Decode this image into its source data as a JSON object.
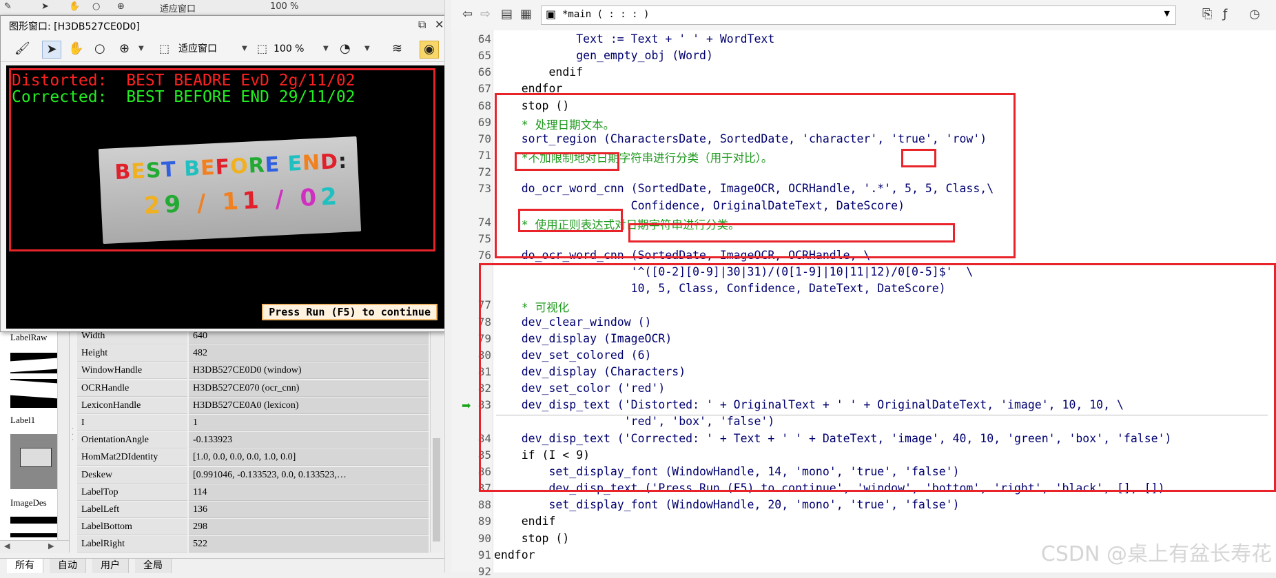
{
  "back_toolbar": {
    "text_fit": "适应窗口",
    "text_zoom": "100 %"
  },
  "graphics_window": {
    "title": "图形窗口: [H3DB527CE0D0]",
    "toolbar": {
      "fit_label": "适应窗口",
      "zoom_value": "100 %"
    },
    "canvas": {
      "distorted_label": "Distorted:",
      "distorted_text": "BEST BEADRE EvD 2g/11/02",
      "corrected_label": "Corrected:",
      "corrected_text": "BEST BEFORE END 29/11/02",
      "label_line1": "BEST BEFORE END:",
      "label_line2": "29 / 11 / 02",
      "press_run": "Press Run (F5) to continue"
    }
  },
  "variables": {
    "thumbs": [
      {
        "label": "LabelRaw"
      },
      {
        "label": "Label1"
      },
      {
        "label": "ImageDes"
      }
    ],
    "rows": [
      {
        "name": "Width",
        "value": "640"
      },
      {
        "name": "Height",
        "value": "482"
      },
      {
        "name": "WindowHandle",
        "value": "H3DB527CE0D0 (window)"
      },
      {
        "name": "OCRHandle",
        "value": "H3DB527CE070 (ocr_cnn)"
      },
      {
        "name": "LexiconHandle",
        "value": "H3DB527CE0A0 (lexicon)"
      },
      {
        "name": "I",
        "value": "1"
      },
      {
        "name": "OrientationAngle",
        "value": "-0.133923"
      },
      {
        "name": "HomMat2DIdentity",
        "value": "[1.0, 0.0, 0.0, 0.0, 1.0, 0.0]"
      },
      {
        "name": "Deskew",
        "value": "[0.991046, -0.133523, 0.0, 0.133523,…"
      },
      {
        "name": "LabelTop",
        "value": "114"
      },
      {
        "name": "LabelLeft",
        "value": "136"
      },
      {
        "name": "LabelBottom",
        "value": "298"
      },
      {
        "name": "LabelRight",
        "value": "522"
      }
    ],
    "tabs": [
      "所有",
      "自动",
      "用户",
      "全局"
    ]
  },
  "editor": {
    "procedure": "*main ( : : : )",
    "lines": [
      {
        "n": "64",
        "t": "            Text := Text + ' ' + WordText",
        "c": "op"
      },
      {
        "n": "65",
        "t": "            gen_empty_obj (Word)",
        "c": "op"
      },
      {
        "n": "66",
        "t": "        endif",
        "c": "kw"
      },
      {
        "n": "67",
        "t": "    endfor",
        "c": "kw"
      },
      {
        "n": "68",
        "t": "    stop ()",
        "c": "kw"
      },
      {
        "n": "69",
        "t": "    * 处理日期文本。",
        "c": "cm"
      },
      {
        "n": "70",
        "t": "    sort_region (CharactersDate, SortedDate, 'character', 'true', 'row')",
        "c": "op"
      },
      {
        "n": "71",
        "t": "    *不加限制地对日期字符串进行分类（用于对比）。",
        "c": "cm"
      },
      {
        "n": "72",
        "t": "",
        "c": "op"
      },
      {
        "n": "73",
        "t": "    do_ocr_word_cnn (SortedDate, ImageOCR, OCRHandle, '.*', 5, 5, Class,\\",
        "c": "op"
      },
      {
        "n": "",
        "t": "                    Confidence, OriginalDateText, DateScore)",
        "c": "op"
      },
      {
        "n": "74",
        "t": "    * 使用正则表达式对日期字符串进行分类。",
        "c": "cm"
      },
      {
        "n": "75",
        "t": "",
        "c": "op"
      },
      {
        "n": "76",
        "t": "    do_ocr_word_cnn (SortedDate, ImageOCR, OCRHandle, \\",
        "c": "op"
      },
      {
        "n": "",
        "t": "                    '^([0-2][0-9]|30|31)/(0[1-9]|10|11|12)/0[0-5]$'  \\",
        "c": "op"
      },
      {
        "n": "",
        "t": "                    10, 5, Class, Confidence, DateText, DateScore)",
        "c": "op"
      },
      {
        "n": "77",
        "t": "    * 可视化",
        "c": "cm"
      },
      {
        "n": "78",
        "t": "    dev_clear_window ()",
        "c": "op"
      },
      {
        "n": "79",
        "t": "    dev_display (ImageOCR)",
        "c": "op"
      },
      {
        "n": "80",
        "t": "    dev_set_colored (6)",
        "c": "op"
      },
      {
        "n": "81",
        "t": "    dev_display (Characters)",
        "c": "op"
      },
      {
        "n": "82",
        "t": "    dev_set_color ('red')",
        "c": "op"
      },
      {
        "n": "83",
        "t": "    dev_disp_text ('Distorted: ' + OriginalText + ' ' + OriginalDateText, 'image', 10, 10, \\",
        "c": "op"
      },
      {
        "n": "",
        "t": "                   'red', 'box', 'false')",
        "c": "op"
      },
      {
        "n": "84",
        "t": "    dev_disp_text ('Corrected: ' + Text + ' ' + DateText, 'image', 40, 10, 'green', 'box', 'false')",
        "c": "op"
      },
      {
        "n": "85",
        "t": "    if (I < 9)",
        "c": "kw"
      },
      {
        "n": "86",
        "t": "        set_display_font (WindowHandle, 14, 'mono', 'true', 'false')",
        "c": "op"
      },
      {
        "n": "87",
        "t": "        dev_disp_text ('Press Run (F5) to continue', 'window', 'bottom', 'right', 'black', [], [])",
        "c": "op"
      },
      {
        "n": "88",
        "t": "        set_display_font (WindowHandle, 20, 'mono', 'true', 'false')",
        "c": "op"
      },
      {
        "n": "89",
        "t": "    endif",
        "c": "kw"
      },
      {
        "n": "90",
        "t": "    stop ()",
        "c": "kw"
      },
      {
        "n": "91",
        "t": "endfor",
        "c": "kw"
      },
      {
        "n": "92",
        "t": "",
        "c": "op"
      }
    ],
    "watermark": "CSDN @桌上有盆长寿花"
  },
  "colors": {
    "highlight_box": "#e8242a",
    "comment": "#1f9a1f",
    "operator": "#000070",
    "pc_arrow": "#1aa31a"
  }
}
